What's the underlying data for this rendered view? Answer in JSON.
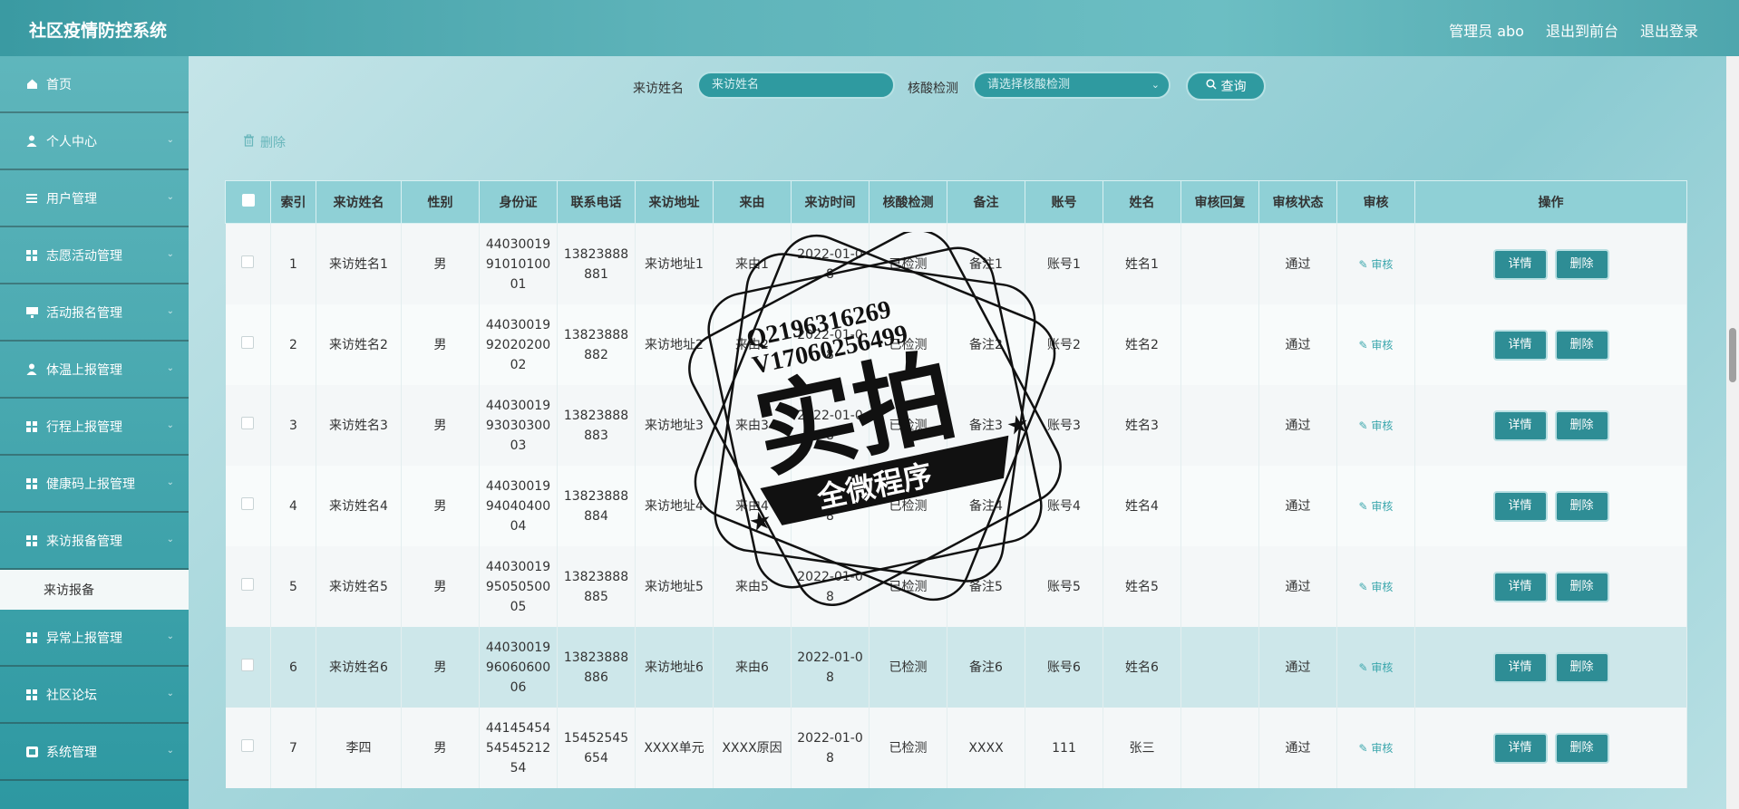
{
  "app": {
    "title": "社区疫情防控系统",
    "user_label": "管理员 abo",
    "to_front_label": "退出到前台",
    "logout_label": "退出登录"
  },
  "sidebar": {
    "items": [
      {
        "label": "首页",
        "icon": "home-icon",
        "chevron": false
      },
      {
        "label": "个人中心",
        "icon": "user-icon",
        "chevron": true
      },
      {
        "label": "用户管理",
        "icon": "list-icon",
        "chevron": true
      },
      {
        "label": "志愿活动管理",
        "icon": "grid-icon",
        "chevron": true
      },
      {
        "label": "活动报名管理",
        "icon": "monitor-icon",
        "chevron": true
      },
      {
        "label": "体温上报管理",
        "icon": "user-icon",
        "chevron": true
      },
      {
        "label": "行程上报管理",
        "icon": "grid-icon",
        "chevron": true
      },
      {
        "label": "健康码上报管理",
        "icon": "grid-icon",
        "chevron": true
      },
      {
        "label": "来访报备管理",
        "icon": "grid-icon",
        "chevron": true
      }
    ],
    "sub_item": "来访报备",
    "items_after": [
      {
        "label": "异常上报管理",
        "icon": "grid-icon",
        "chevron": true
      },
      {
        "label": "社区论坛",
        "icon": "grid-icon",
        "chevron": true
      },
      {
        "label": "系统管理",
        "icon": "settings-icon",
        "chevron": true
      }
    ]
  },
  "search": {
    "name_label": "来访姓名",
    "name_placeholder": "来访姓名",
    "test_label": "核酸检测",
    "test_placeholder": "请选择核酸检测",
    "query_label": "查询"
  },
  "toolbar": {
    "delete_label": "删除"
  },
  "table": {
    "headers": [
      "索引",
      "来访姓名",
      "性别",
      "身份证",
      "联系电话",
      "来访地址",
      "来由",
      "来访时间",
      "核酸检测",
      "备注",
      "账号",
      "姓名",
      "审核回复",
      "审核状态",
      "审核",
      "操作"
    ],
    "audit_link": "审核",
    "detail_label": "详情",
    "delete_label": "删除",
    "rows": [
      {
        "idx": "1",
        "name": "来访姓名1",
        "sex": "男",
        "id": "440300199101010001",
        "phone": "13823888881",
        "addr": "来访地址1",
        "reason": "来由1",
        "time": "2022-01-08",
        "test": "已检测",
        "note": "备注1",
        "account": "账号1",
        "realname": "姓名1",
        "reply": "",
        "status": "通过"
      },
      {
        "idx": "2",
        "name": "来访姓名2",
        "sex": "男",
        "id": "440300199202020002",
        "phone": "13823888882",
        "addr": "来访地址2",
        "reason": "来由2",
        "time": "2022-01-08",
        "test": "已检测",
        "note": "备注2",
        "account": "账号2",
        "realname": "姓名2",
        "reply": "",
        "status": "通过"
      },
      {
        "idx": "3",
        "name": "来访姓名3",
        "sex": "男",
        "id": "440300199303030003",
        "phone": "13823888883",
        "addr": "来访地址3",
        "reason": "来由3",
        "time": "2022-01-08",
        "test": "已检测",
        "note": "备注3",
        "account": "账号3",
        "realname": "姓名3",
        "reply": "",
        "status": "通过"
      },
      {
        "idx": "4",
        "name": "来访姓名4",
        "sex": "男",
        "id": "440300199404040004",
        "phone": "13823888884",
        "addr": "来访地址4",
        "reason": "来由4",
        "time": "2022-01-08",
        "test": "已检测",
        "note": "备注4",
        "account": "账号4",
        "realname": "姓名4",
        "reply": "",
        "status": "通过"
      },
      {
        "idx": "5",
        "name": "来访姓名5",
        "sex": "男",
        "id": "440300199505050005",
        "phone": "13823888885",
        "addr": "来访地址5",
        "reason": "来由5",
        "time": "2022-01-08",
        "test": "已检测",
        "note": "备注5",
        "account": "账号5",
        "realname": "姓名5",
        "reply": "",
        "status": "通过"
      },
      {
        "idx": "6",
        "name": "来访姓名6",
        "sex": "男",
        "id": "440300199606060006",
        "phone": "13823888886",
        "addr": "来访地址6",
        "reason": "来由6",
        "time": "2022-01-08",
        "test": "已检测",
        "note": "备注6",
        "account": "账号6",
        "realname": "姓名6",
        "reply": "",
        "status": "通过"
      },
      {
        "idx": "7",
        "name": "李四",
        "sex": "男",
        "id": "441454545454521254",
        "phone": "15452545654",
        "addr": "XXXX单元",
        "reason": "XXXX原因",
        "time": "2022-01-08",
        "test": "已检测",
        "note": "XXXX",
        "account": "111",
        "realname": "张三",
        "reply": "",
        "status": "通过"
      }
    ]
  },
  "watermark": {
    "line1": "Q2196316269",
    "line2": "V17060256499",
    "big": "实拍",
    "banner": "全微程序"
  }
}
